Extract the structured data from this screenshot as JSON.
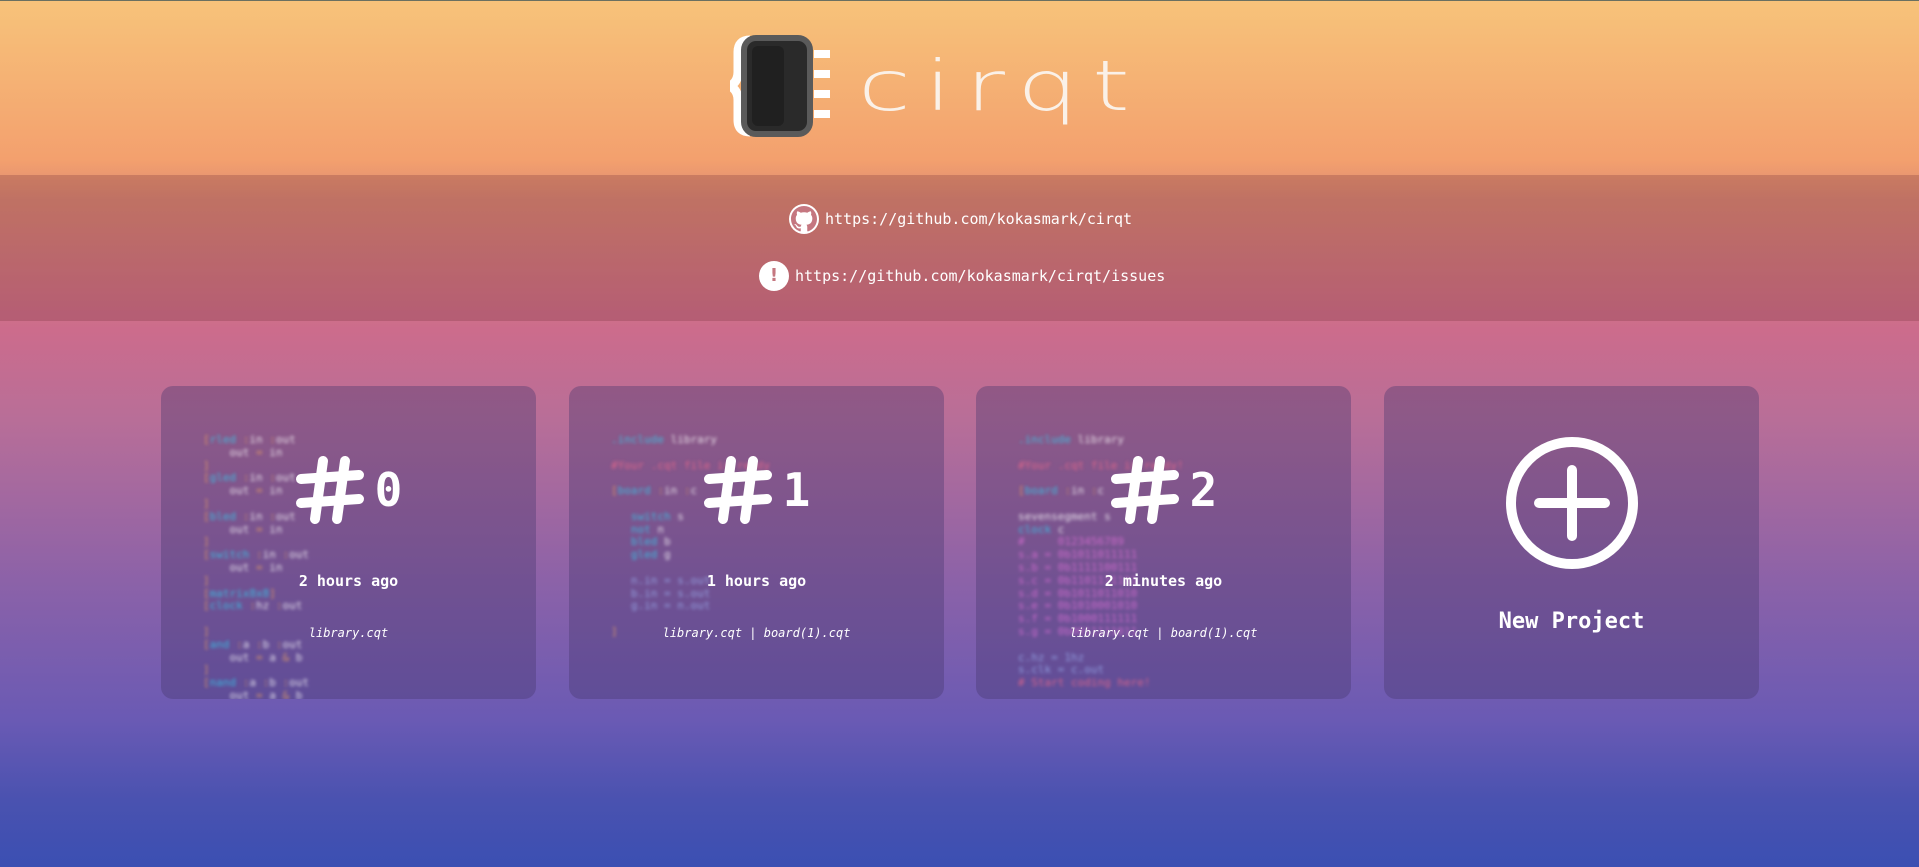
{
  "app": {
    "name": "cirqt"
  },
  "links": {
    "github": {
      "icon": "github-icon",
      "url": "https://github.com/kokasmark/cirqt"
    },
    "issues": {
      "icon": "exclamation-icon",
      "url": "https://github.com/kokasmark/cirqt/issues"
    }
  },
  "projects": [
    {
      "number": "0",
      "time": "2 hours ago",
      "files": "library.cqt"
    },
    {
      "number": "1",
      "time": "1 hours ago",
      "files": "library.cqt | board(1).cqt"
    },
    {
      "number": "2",
      "time": "2 minutes ago",
      "files": "library.cqt | board(1).cqt"
    }
  ],
  "new_project": {
    "label": "New Project",
    "icon": "plus-circle-icon"
  },
  "colors": {
    "gradient_top": "#f7c37a",
    "gradient_bottom": "#3b4fb2",
    "code_keyword": "#31d0f0",
    "code_operator": "#f4a860",
    "code_comment": "#f36a8a"
  }
}
